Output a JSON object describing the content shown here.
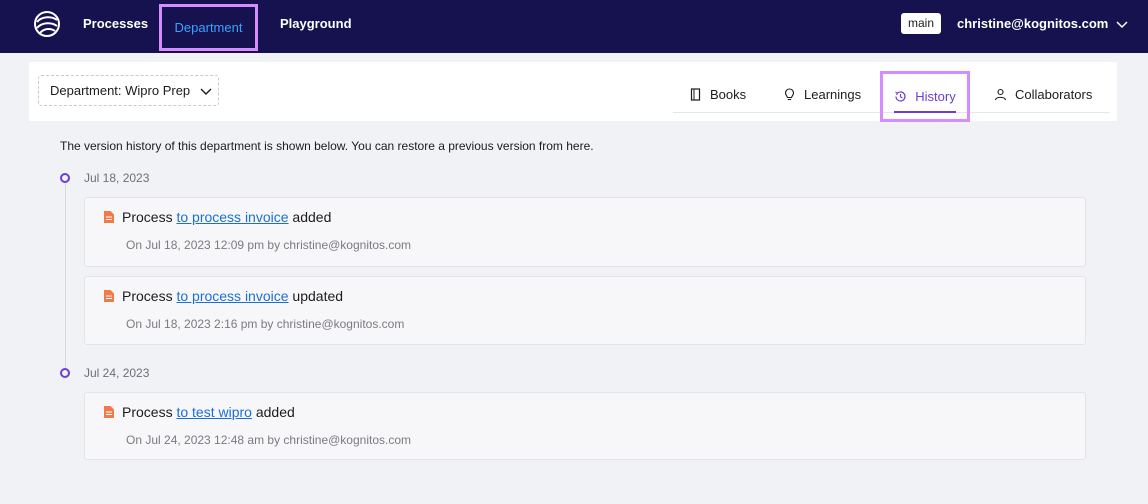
{
  "topbar": {
    "nav": [
      {
        "label": "Processes"
      },
      {
        "label": "Department"
      },
      {
        "label": "Playground"
      }
    ],
    "branch": "main",
    "user": "christine@kognitos.com"
  },
  "subheader": {
    "department_select": "Department: Wipro Prep",
    "tabs": [
      {
        "label": "Books",
        "icon": "book-icon"
      },
      {
        "label": "Learnings",
        "icon": "lightbulb-icon"
      },
      {
        "label": "History",
        "icon": "history-icon",
        "active": true
      },
      {
        "label": "Collaborators",
        "icon": "user-icon"
      }
    ]
  },
  "history": {
    "intro": "The version history of this department is shown below. You can restore a previous version from here.",
    "groups": [
      {
        "date": "Jul 18, 2023",
        "entries": [
          {
            "prefix": "Process",
            "link": "to process invoice",
            "action": "added",
            "meta": "On Jul 18, 2023 12:09 pm by christine@kognitos.com"
          },
          {
            "prefix": "Process",
            "link": "to process invoice",
            "action": "updated",
            "meta": "On Jul 18, 2023 2:16 pm by christine@kognitos.com"
          }
        ]
      },
      {
        "date": "Jul 24, 2023",
        "entries": [
          {
            "prefix": "Process",
            "link": "to test wipro",
            "action": "added",
            "meta": "On Jul 24, 2023 12:48 am by christine@kognitos.com"
          }
        ]
      }
    ]
  },
  "colors": {
    "topbar_bg": "#16124f",
    "accent": "#6b3fd6",
    "link": "#1a6fd6",
    "highlight": "#d48cff",
    "doc_icon": "#f07a4a"
  }
}
